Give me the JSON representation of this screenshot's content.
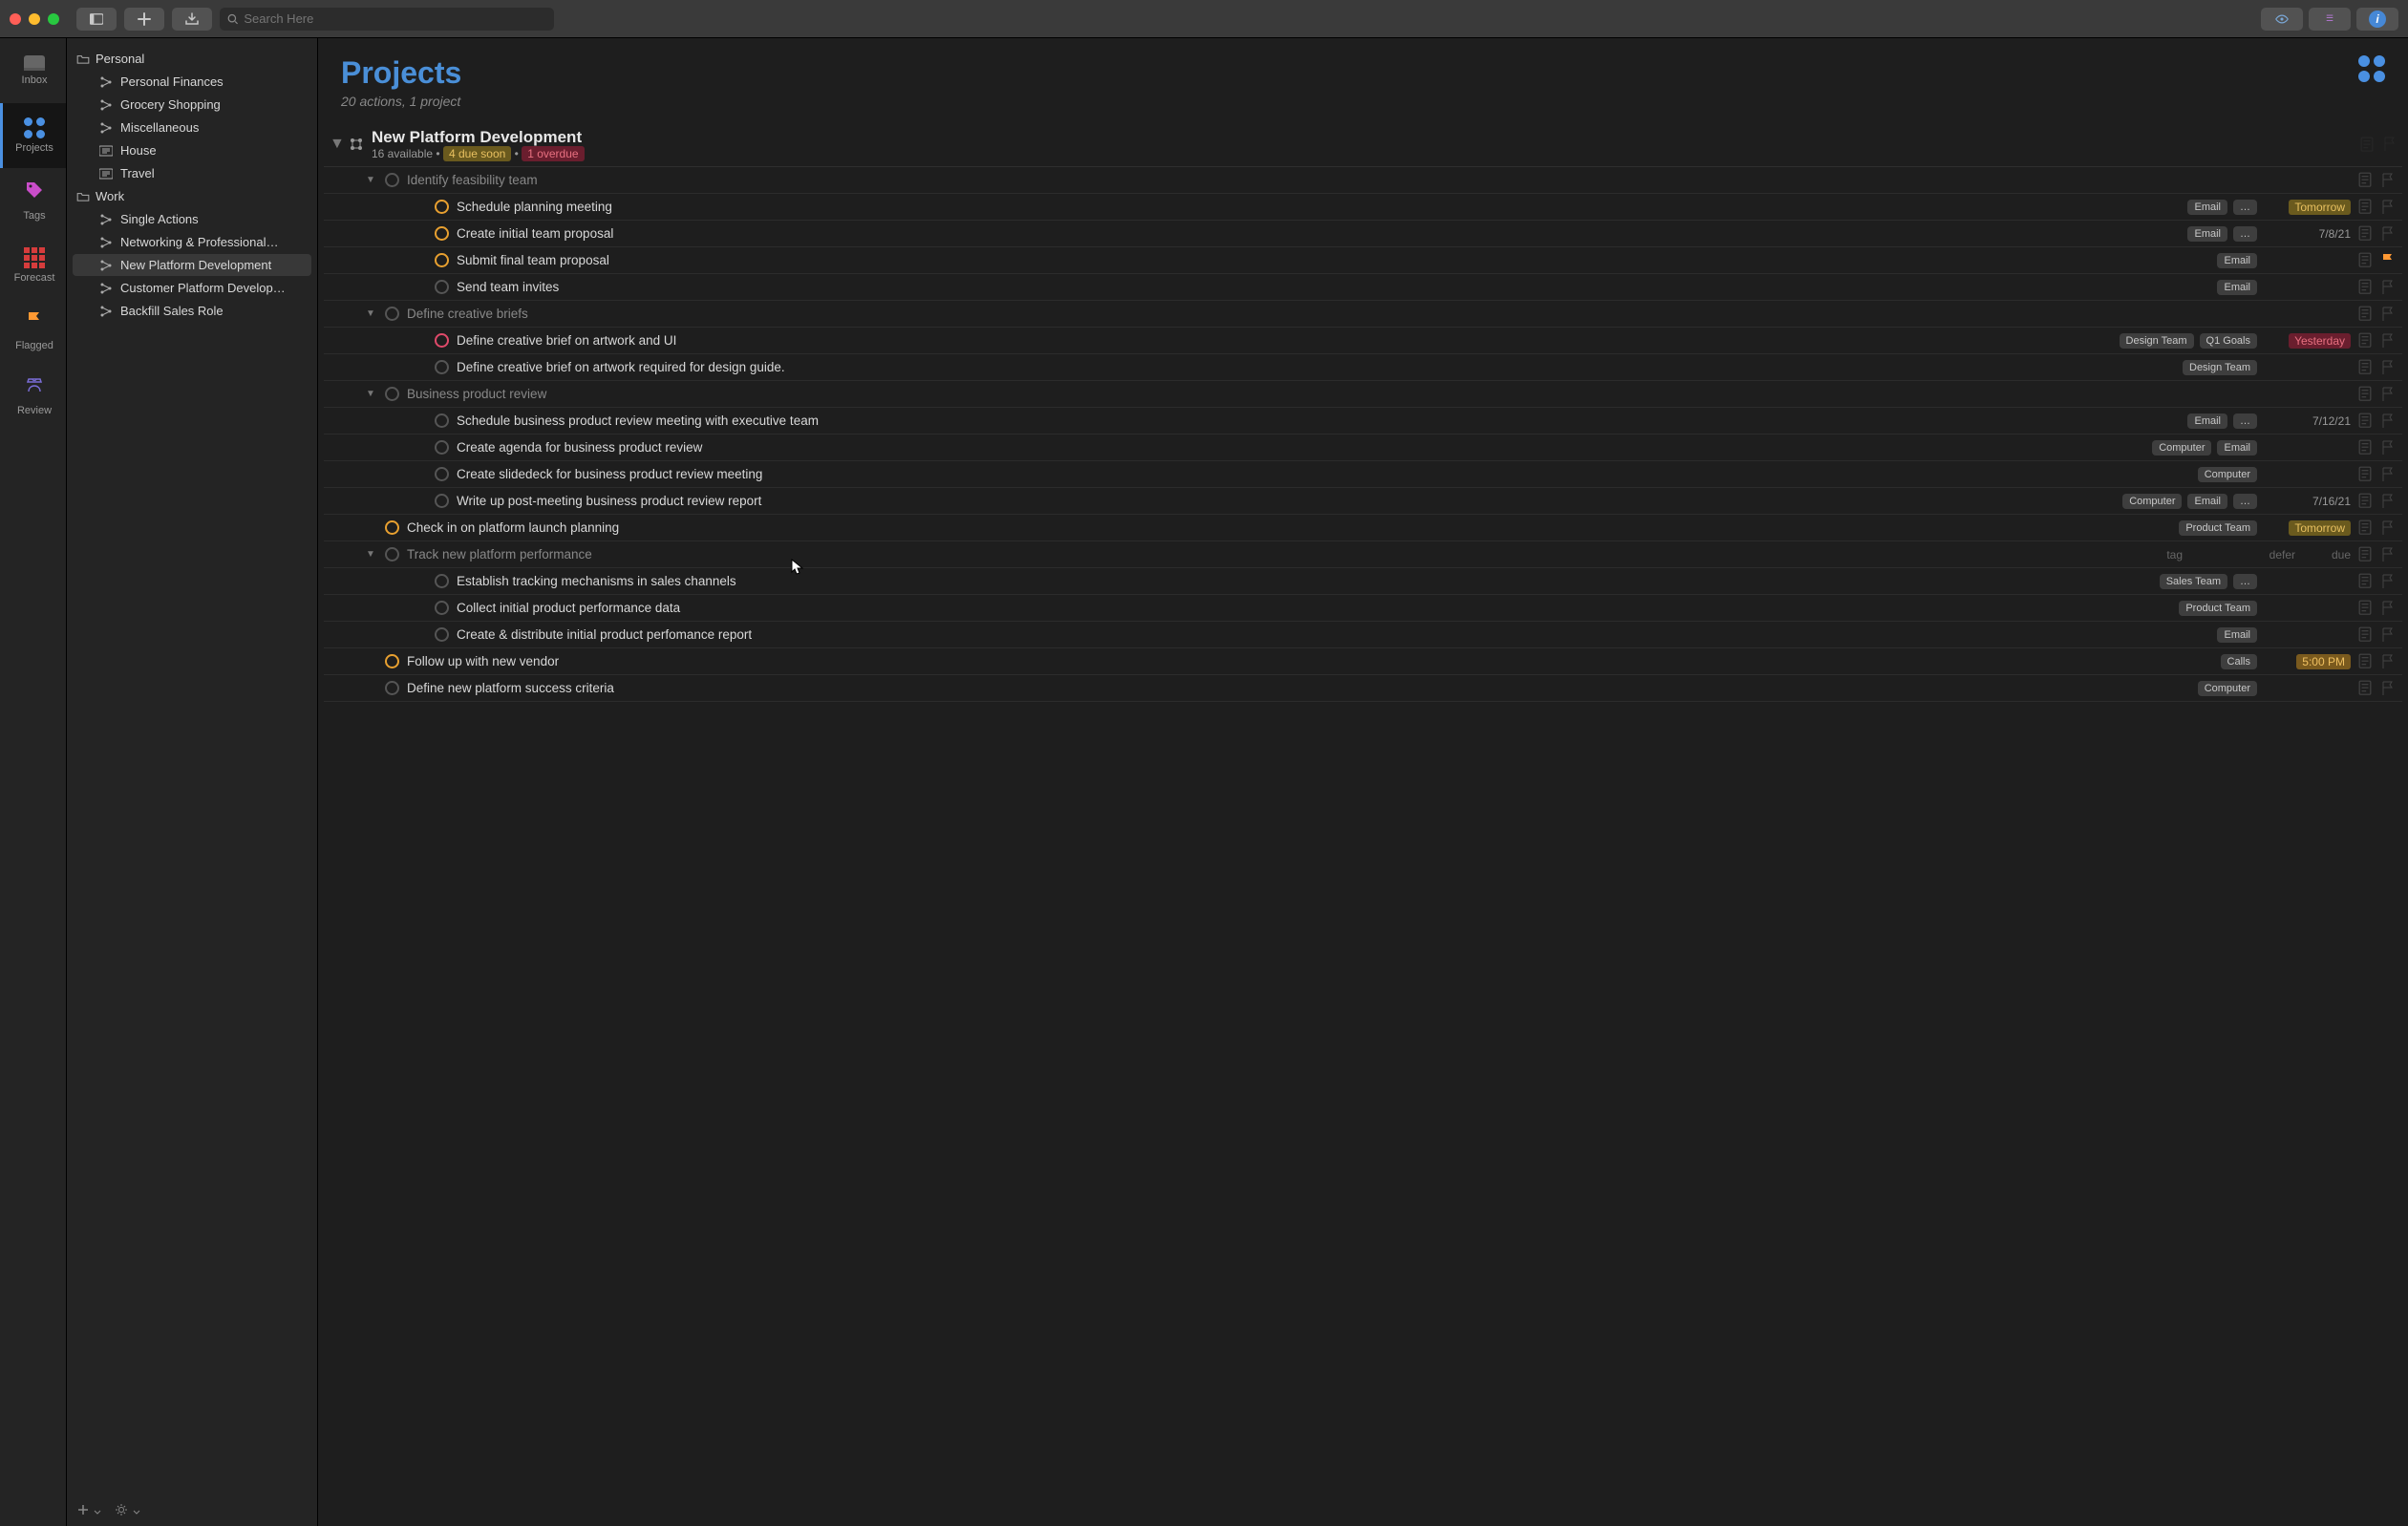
{
  "search": {
    "placeholder": "Search Here"
  },
  "perspectives": [
    {
      "id": "inbox",
      "label": "Inbox"
    },
    {
      "id": "projects",
      "label": "Projects"
    },
    {
      "id": "tags",
      "label": "Tags"
    },
    {
      "id": "forecast",
      "label": "Forecast"
    },
    {
      "id": "flagged",
      "label": "Flagged"
    },
    {
      "id": "review",
      "label": "Review"
    }
  ],
  "sidebar": {
    "folders": [
      {
        "name": "Personal",
        "items": [
          {
            "type": "proj",
            "label": "Personal Finances"
          },
          {
            "type": "proj",
            "label": "Grocery Shopping"
          },
          {
            "type": "proj",
            "label": "Miscellaneous"
          },
          {
            "type": "single",
            "label": "House"
          },
          {
            "type": "single",
            "label": "Travel"
          }
        ]
      },
      {
        "name": "Work",
        "items": [
          {
            "type": "proj",
            "label": "Single Actions"
          },
          {
            "type": "proj",
            "label": "Networking & Professional…"
          },
          {
            "type": "proj",
            "label": "New Platform Development",
            "selected": true
          },
          {
            "type": "proj",
            "label": "Customer Platform Develop…"
          },
          {
            "type": "proj",
            "label": "Backfill Sales Role"
          }
        ]
      }
    ]
  },
  "header": {
    "title": "Projects",
    "subtitle": "20 actions, 1 project"
  },
  "project": {
    "name": "New Platform Development",
    "available": "16 available",
    "due_soon": "4 due soon",
    "overdue": "1 overdue"
  },
  "placeholder_labels": {
    "tag": "tag",
    "defer": "defer",
    "due": "due"
  },
  "tasks": [
    {
      "level": 1,
      "group": true,
      "name": "Identify feasibility team"
    },
    {
      "level": 2,
      "circle": "orange",
      "name": "Schedule planning meeting",
      "tags": [
        "Email",
        "…"
      ],
      "due": "Tomorrow",
      "due_style": "tomorrow"
    },
    {
      "level": 2,
      "circle": "orange",
      "name": "Create initial team proposal",
      "tags": [
        "Email",
        "…"
      ],
      "due": "7/8/21",
      "due_style": "plain"
    },
    {
      "level": 2,
      "circle": "orange",
      "name": "Submit final team proposal",
      "tags": [
        "Email"
      ],
      "flagged": true
    },
    {
      "level": 2,
      "circle": "",
      "name": "Send team invites",
      "tags": [
        "Email"
      ]
    },
    {
      "level": 1,
      "group": true,
      "name": "Define creative briefs"
    },
    {
      "level": 2,
      "circle": "red",
      "name": "Define creative brief on artwork and UI",
      "tags": [
        "Design Team",
        "Q1 Goals"
      ],
      "due": "Yesterday",
      "due_style": "yesterday"
    },
    {
      "level": 2,
      "circle": "",
      "name": "Define creative brief on artwork required for design guide.",
      "tags": [
        "Design Team"
      ]
    },
    {
      "level": 1,
      "group": true,
      "name": "Business product review"
    },
    {
      "level": 2,
      "circle": "",
      "name": "Schedule business product review meeting with executive team",
      "tags": [
        "Email",
        "…"
      ],
      "due": "7/12/21",
      "due_style": "plain"
    },
    {
      "level": 2,
      "circle": "",
      "name": "Create agenda for business product review",
      "tags": [
        "Computer",
        "Email"
      ]
    },
    {
      "level": 2,
      "circle": "",
      "name": "Create slidedeck for business product review meeting",
      "tags": [
        "Computer"
      ]
    },
    {
      "level": 2,
      "circle": "",
      "name": "Write up post-meeting business product review report",
      "tags": [
        "Computer",
        "Email",
        "…"
      ],
      "due": "7/16/21",
      "due_style": "plain"
    },
    {
      "level": 1,
      "circle": "orange",
      "name": "Check in on platform launch planning",
      "tags": [
        "Product Team"
      ],
      "due": "Tomorrow",
      "due_style": "tomorrow"
    },
    {
      "level": 1,
      "group": true,
      "placeholder": true,
      "name": "Track new platform performance"
    },
    {
      "level": 2,
      "circle": "",
      "name": "Establish tracking mechanisms in sales channels",
      "tags": [
        "Sales Team",
        "…"
      ]
    },
    {
      "level": 2,
      "circle": "",
      "name": "Collect initial product performance data",
      "tags": [
        "Product Team"
      ]
    },
    {
      "level": 2,
      "circle": "",
      "name": "Create & distribute initial product perfomance report",
      "tags": [
        "Email"
      ]
    },
    {
      "level": 1,
      "circle": "orange",
      "name": "Follow up with new vendor",
      "tags": [
        "Calls"
      ],
      "due": "5:00 PM",
      "due_style": "orange-time"
    },
    {
      "level": 1,
      "circle": "",
      "name": "Define new platform success criteria",
      "tags": [
        "Computer"
      ]
    }
  ]
}
